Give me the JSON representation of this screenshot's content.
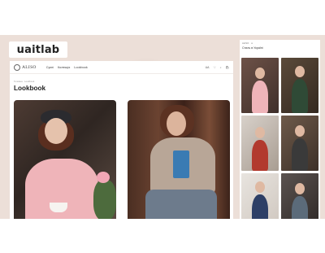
{
  "brand": {
    "name": "uaitlab"
  },
  "desktop": {
    "logo_text": "ALISO",
    "menu": [
      "Сукні",
      "Колекція",
      "Lookbook"
    ],
    "nav_right": [
      "UA",
      "♡",
      "⌕",
      "🛍"
    ],
    "breadcrumb": "Головна · Lookbook",
    "page_title": "Lookbook"
  },
  "mobile": {
    "top_items": [
      "ALISO",
      "≡"
    ],
    "title": "Стиль в Україні"
  },
  "colors": {
    "background_band": "#ecdfd8",
    "pink_sweater": "#efb4b9",
    "beige_sweater": "#b8a697"
  },
  "icons": [
    "logo-circle-icon",
    "heart-icon",
    "search-icon",
    "bag-icon",
    "menu-icon"
  ]
}
